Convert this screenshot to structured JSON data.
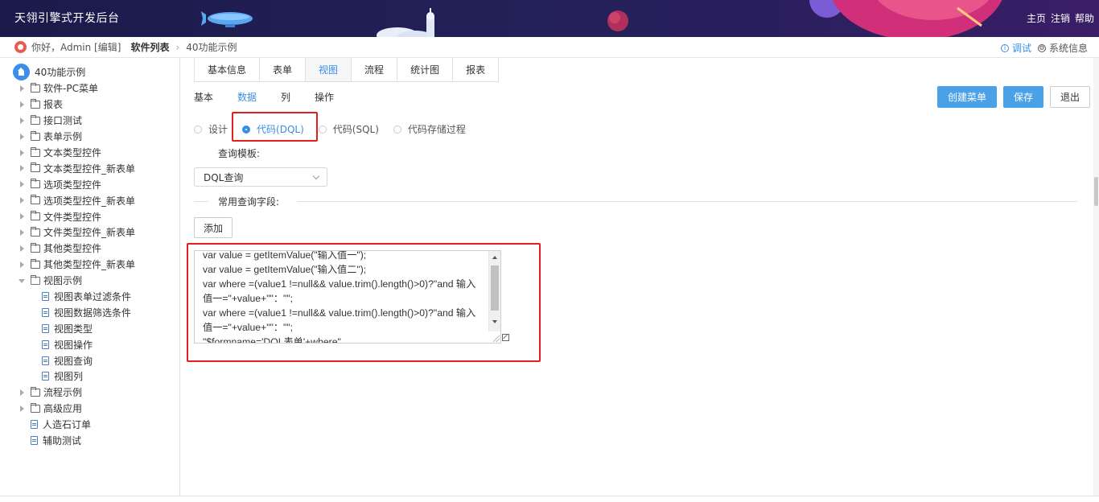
{
  "header": {
    "title": "天翎引擎式开发后台",
    "links": [
      "主页",
      "注销",
      "帮助"
    ]
  },
  "crumb": {
    "greeting": "你好，Admin [编辑]",
    "software_list": "软件列表",
    "current": "40功能示例",
    "debug": "调试",
    "system_info": "系统信息"
  },
  "tree": {
    "root": "40功能示例",
    "items": [
      {
        "label": "软件-PC菜单",
        "type": "folder"
      },
      {
        "label": "报表",
        "type": "folder"
      },
      {
        "label": "接口测试",
        "type": "folder"
      },
      {
        "label": "表单示例",
        "type": "folder"
      },
      {
        "label": "文本类型控件",
        "type": "folder"
      },
      {
        "label": "文本类型控件_新表单",
        "type": "folder"
      },
      {
        "label": "选项类型控件",
        "type": "folder"
      },
      {
        "label": "选项类型控件_新表单",
        "type": "folder"
      },
      {
        "label": "文件类型控件",
        "type": "folder"
      },
      {
        "label": "文件类型控件_新表单",
        "type": "folder"
      },
      {
        "label": "其他类型控件",
        "type": "folder"
      },
      {
        "label": "其他类型控件_新表单",
        "type": "folder"
      },
      {
        "label": "视图示例",
        "type": "folder-open"
      },
      {
        "label": "视图表单过滤条件",
        "type": "child"
      },
      {
        "label": "视图数据筛选条件",
        "type": "child"
      },
      {
        "label": "视图类型",
        "type": "child"
      },
      {
        "label": "视图操作",
        "type": "child"
      },
      {
        "label": "视图查询",
        "type": "child"
      },
      {
        "label": "视图列",
        "type": "child"
      },
      {
        "label": "流程示例",
        "type": "folder"
      },
      {
        "label": "高级应用",
        "type": "folder"
      },
      {
        "label": "人造石订单",
        "type": "leaf"
      },
      {
        "label": "辅助测试",
        "type": "leaf"
      }
    ]
  },
  "tabs": [
    "基本信息",
    "表单",
    "视图",
    "流程",
    "统计图",
    "报表"
  ],
  "active_tab": 2,
  "subtabs": [
    "基本",
    "数据",
    "列",
    "操作"
  ],
  "active_subtab": 1,
  "actions": {
    "create_menu": "创建菜单",
    "save": "保存",
    "exit": "退出"
  },
  "radios": [
    "设计",
    "代码(DQL)",
    "代码(SQL)",
    "代码存储过程"
  ],
  "checked_radio": 1,
  "query_template": {
    "label": "查询模板:",
    "value": "DQL查询"
  },
  "common_fields": {
    "label": "常用查询字段:",
    "add_button": "添加"
  },
  "code": "var value = getItemValue(\"输入值一\");\nvar value = getItemValue(\"输入值二\");\nvar where =(value1 !=null&& value.trim().length()>0)?\"and 输入值一=\"+value+\"\"：\"\";\nvar where =(value1 !=null&& value.trim().length()>0)?\"and 输入值一=\"+value+\"\"：\"\";\n\"$formname='DQL表单'+where\"",
  "colors": {
    "accent": "#3a8ee6",
    "primary_button": "#4aa1e8",
    "highlight": "#e02020"
  }
}
